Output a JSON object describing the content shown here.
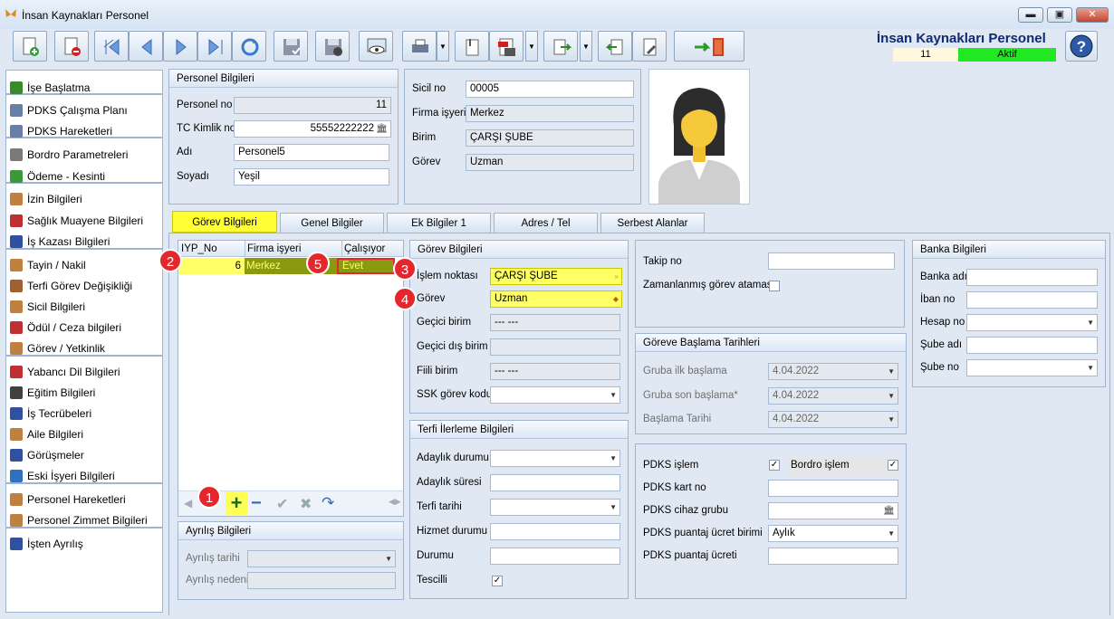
{
  "window": {
    "title": "İnsan Kaynakları Personel",
    "minimize": "▬",
    "maximize": "▣",
    "close": "✕"
  },
  "app": {
    "title": "İnsan Kaynakları Personel",
    "record_no": "11",
    "status": "Aktif",
    "status_color": "#22e822",
    "help_icon": "question-icon"
  },
  "sidebar": {
    "items": [
      {
        "label": "İşe Başlatma",
        "icon": "flag-icon",
        "color": "#3a8a2a"
      },
      {
        "label": "PDKS Çalışma Planı",
        "icon": "schedule-icon",
        "color": "#6a7fa8"
      },
      {
        "label": "PDKS Hareketleri",
        "icon": "list-icon",
        "color": "#6a7fa8"
      },
      {
        "label": "Bordro Parametreleri",
        "icon": "document-icon",
        "color": "#7a7a7a"
      },
      {
        "label": "Ödeme - Kesinti",
        "icon": "payment-icon",
        "color": "#3a9a3a"
      },
      {
        "label": "İzin Bilgileri",
        "icon": "person-leave-icon",
        "color": "#c08040"
      },
      {
        "label": "Sağlık Muayene Bilgileri",
        "icon": "health-icon",
        "color": "#c03030"
      },
      {
        "label": "İş Kazası Bilgileri",
        "icon": "accident-icon",
        "color": "#3050a0"
      },
      {
        "label": "Tayin / Nakil",
        "icon": "transfer-icon",
        "color": "#c08040"
      },
      {
        "label": "Terfi Görev Değişikliği",
        "icon": "promotion-icon",
        "color": "#a06030"
      },
      {
        "label": "Sicil Bilgileri",
        "icon": "person-icon",
        "color": "#c08040"
      },
      {
        "label": "Ödül / Ceza bilgileri",
        "icon": "award-icon",
        "color": "#c03030"
      },
      {
        "label": "Görev / Yetkinlik",
        "icon": "task-icon",
        "color": "#c08040"
      },
      {
        "label": "Yabancı Dil Bilgileri",
        "icon": "language-icon",
        "color": "#c03030"
      },
      {
        "label": "Eğitim Bilgileri",
        "icon": "education-icon",
        "color": "#404040"
      },
      {
        "label": "İş Tecrübeleri",
        "icon": "experience-icon",
        "color": "#3050a0"
      },
      {
        "label": "Aile Bilgileri",
        "icon": "family-icon",
        "color": "#c08040"
      },
      {
        "label": "Görüşmeler",
        "icon": "meeting-icon",
        "color": "#3050a0"
      },
      {
        "label": "Eski İşyeri Bilgileri",
        "icon": "info-icon",
        "color": "#3070c0"
      },
      {
        "label": "Personel Hareketleri",
        "icon": "movement-icon",
        "color": "#c08040"
      },
      {
        "label": "Personel Zimmet Bilgileri",
        "icon": "assets-icon",
        "color": "#c08040"
      },
      {
        "label": "İşten Ayrılış",
        "icon": "exit-icon",
        "color": "#3050a0"
      }
    ]
  },
  "personel": {
    "header": "Personel Bilgileri",
    "personel_no_label": "Personel no",
    "personel_no": "11",
    "tc_label": "TC Kimlik no",
    "tc": "55552222222",
    "ad_label": "Adı",
    "ad": "Personel5",
    "soyad_label": "Soyadı",
    "soyad": "Yeşil"
  },
  "sicil": {
    "sicil_label": "Sicil no",
    "sicil": "00005",
    "firma_label": "Firma işyeri",
    "firma": "Merkez",
    "birim_label": "Birim",
    "birim": "ÇARŞI ŞUBE",
    "gorev_label": "Görev",
    "gorev": "Uzman"
  },
  "tabs": [
    "Görev Bilgileri",
    "Genel Bilgiler",
    "Ek Bilgiler 1",
    "Adres / Tel",
    "Serbest Alanlar"
  ],
  "grid": {
    "columns": [
      "IYP_No",
      "Firma işyeri",
      "Çalışıyor"
    ],
    "rows": [
      {
        "iyp_no": "6",
        "firma": "Merkez",
        "calisiyor": "Evet"
      }
    ]
  },
  "badges": [
    "1",
    "2",
    "3",
    "4",
    "5"
  ],
  "ayrilis": {
    "header": "Ayrılış Bilgileri",
    "tarih_label": "Ayrılış tarihi",
    "neden_label": "Ayrılış nedeni"
  },
  "gorev_bilgileri": {
    "header": "Görev Bilgileri",
    "islem_noktasi_label": "İşlem noktası",
    "islem_noktasi": "ÇARŞI ŞUBE",
    "gorev_label": "Görev",
    "gorev": "Uzman",
    "gecici_birim_label": "Geçici birim",
    "gecici_birim": "--- ---",
    "gecici_dis_birim_label": "Geçici dış birim",
    "fiili_birim_label": "Fiili birim",
    "fiili_birim": "--- ---",
    "ssk_label": "SSK görev kodu"
  },
  "terfi": {
    "header": "Terfi İlerleme Bilgileri",
    "adaylik_durumu_label": "Adaylık durumu",
    "adaylik_suresi_label": "Adaylık süresi",
    "terfi_tarihi_label": "Terfi tarihi",
    "hizmet_durumu_label": "Hizmet durumu",
    "durumu_label": "Durumu",
    "tescilli_label": "Tescilli",
    "tescilli": true
  },
  "takip": {
    "takip_label": "Takip no",
    "zaman_label": "Zamanlanmış görev ataması"
  },
  "baslama": {
    "header": "Göreve Başlama Tarihleri",
    "grup_ilk_label": "Gruba ilk başlama",
    "grup_ilk": "4.04.2022",
    "grup_son_label": "Gruba son başlama*",
    "grup_son": "4.04.2022",
    "baslama_label": "Başlama Tarihi",
    "baslama": "4.04.2022"
  },
  "pdks": {
    "islem_label": "PDKS işlem",
    "bordro_label": "Bordro işlem",
    "kart_label": "PDKS kart no",
    "cihaz_label": "PDKS cihaz grubu",
    "ucret_birimi_label": "PDKS puantaj ücret birimi",
    "ucret_birimi": "Aylık",
    "ucret_label": "PDKS puantaj ücreti"
  },
  "banka": {
    "header": "Banka Bilgileri",
    "banka_label": "Banka adı",
    "iban_label": "İban no",
    "hesap_label": "Hesap no",
    "sube_adi_label": "Şube adı",
    "sube_no_label": "Şube no"
  }
}
